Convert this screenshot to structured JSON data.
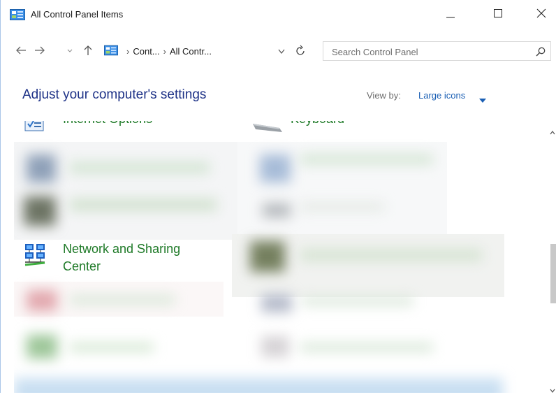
{
  "window": {
    "title": "All Control Panel Items",
    "controls": {
      "minimize": "minimize",
      "maximize": "maximize",
      "close": "close"
    }
  },
  "nav": {
    "breadcrumbs": [
      "Cont...",
      "All Contr..."
    ],
    "search_placeholder": "Search Control Panel"
  },
  "header": {
    "title": "Adjust your computer's settings",
    "view_by_label": "View by:",
    "view_by_value": "Large icons"
  },
  "items": {
    "internet_options": "Internet Options",
    "keyboard": "Keyboard",
    "network_line1": "Network and Sharing",
    "network_line2": "Center"
  },
  "colors": {
    "heading": "#1e3287",
    "link_green": "#1f7a28",
    "view_value": "#1a5fb4"
  }
}
